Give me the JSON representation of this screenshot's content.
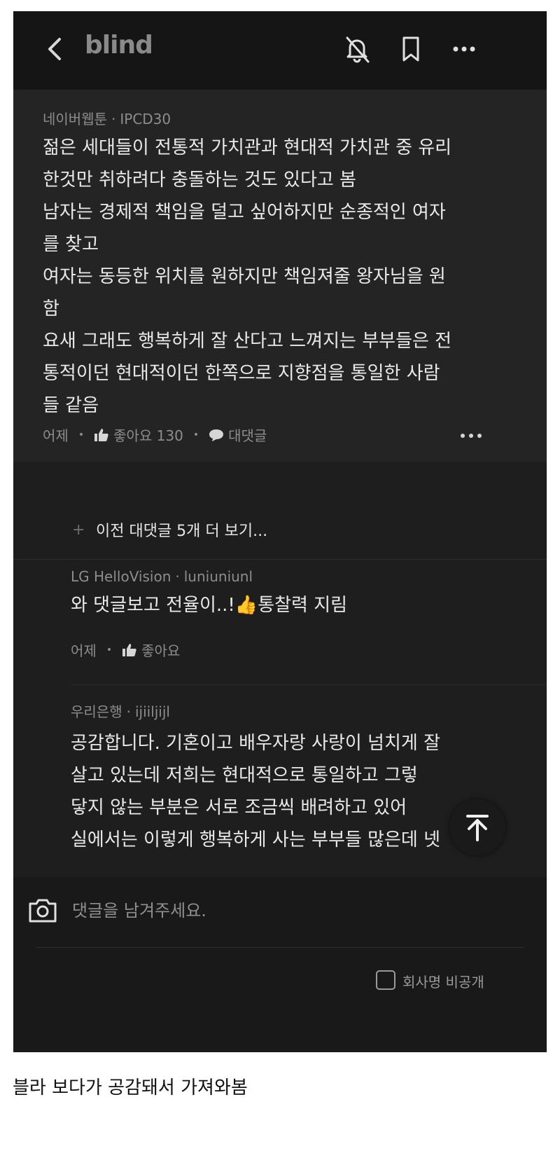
{
  "header": {
    "brand": "blind"
  },
  "comment": {
    "company": "네이버웹툰",
    "username": "IPCD30",
    "lines": [
      "젊은 세대들이 전통적 가치관과 현대적 가치관 중 유리",
      "한것만 취하려다 충돌하는 것도 있다고 봄",
      "남자는 경제적 책임을 덜고 싶어하지만 순종적인 여자",
      "를 찾고",
      "여자는 동등한 위치를 원하지만 책임져줄 왕자님을 원",
      "함",
      "요새 그래도 행복하게 잘 산다고 느껴지는 부부들은 전",
      "통적이던 현대적이던 한쪽으로 지향점을 통일한 사람",
      "들 같음"
    ],
    "time": "어제",
    "like_label": "좋아요 130",
    "reply_label": "대댓글"
  },
  "load_more": {
    "label": "이전 대댓글 5개 더 보기..."
  },
  "replies": [
    {
      "company": "LG HelloVision",
      "username": "luniuniunl",
      "text": "와 댓글보고 전율이..!👍통찰력 지림",
      "time": "어제",
      "like_label": "좋아요"
    },
    {
      "company": "우리은행",
      "username": "ijiiljijl",
      "lines": [
        "공감합니다. 기혼이고 배우자랑 사랑이 넘치게 잘",
        "살고 있는데 저희는 현대적으로 통일하고 그렇",
        "닿지 않는 부분은 서로 조금씩 배려하고 있어",
        "실에서는 이렇게 행복하게 사는 부부들 많은데 넷"
      ]
    }
  ],
  "input": {
    "placeholder": "댓글을 남겨주세요."
  },
  "privacy": {
    "label": "회사명 비공개"
  },
  "caption": "블라 보다가 공감돼서 가져와봄"
}
